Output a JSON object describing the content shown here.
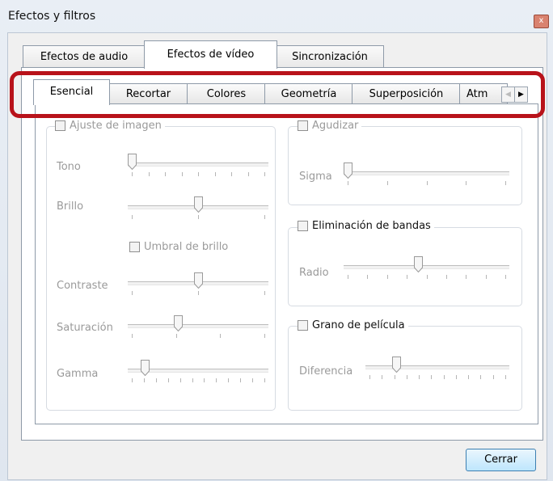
{
  "window": {
    "title": "Efectos y filtros",
    "close_glyph": "x"
  },
  "outer_tabs": [
    "Efectos de audio",
    "Efectos de vídeo",
    "Sincronización"
  ],
  "inner_tabs": [
    "Esencial",
    "Recortar",
    "Colores",
    "Geometría",
    "Superposición",
    "Atm"
  ],
  "scroll": {
    "left": "◀",
    "right": "▶"
  },
  "image_adjust": {
    "checkbox_label": "Ajuste de imagen",
    "tono": {
      "label": "Tono",
      "value": 0.0
    },
    "brillo": {
      "label": "Brillo",
      "value": 0.5
    },
    "umbral_label": "Umbral de brillo",
    "contraste": {
      "label": "Contraste",
      "value": 0.5
    },
    "saturacion": {
      "label": "Saturación",
      "value": 0.35
    },
    "gamma": {
      "label": "Gamma",
      "value": 0.1
    }
  },
  "sharpen": {
    "checkbox_label": "Agudizar",
    "sigma": {
      "label": "Sigma",
      "value": 0.0
    }
  },
  "banding": {
    "checkbox_label": "Eliminación de bandas",
    "radio": {
      "label": "Radio",
      "value": 0.45
    }
  },
  "grain": {
    "checkbox_label": "Grano de película",
    "diferencia": {
      "label": "Diferencia",
      "value": 0.2
    }
  },
  "footer": {
    "close_label": "Cerrar"
  },
  "colors": {
    "highlight": "#b8121a",
    "button_border": "#3c7fb1"
  }
}
